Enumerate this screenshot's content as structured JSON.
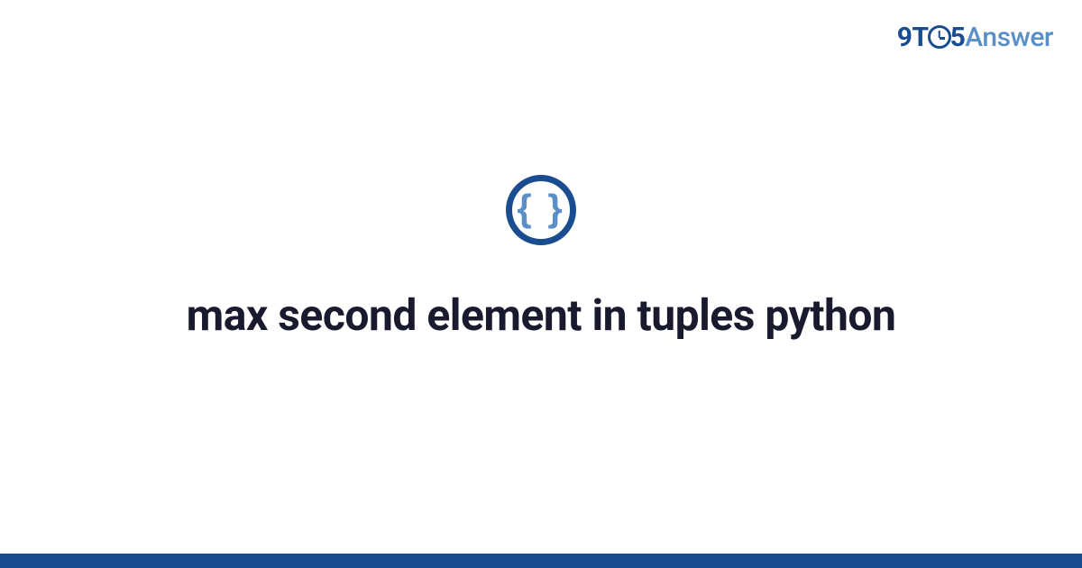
{
  "logo": {
    "part1": "9",
    "part2": "T",
    "part3": "5",
    "part4": "Answer"
  },
  "icon": {
    "name": "code-braces-icon",
    "glyph": "{ }"
  },
  "title": "max second element in tuples python",
  "colors": {
    "primary": "#1a4d8f",
    "accent": "#5b8fc7",
    "text": "#1a1a2e"
  }
}
